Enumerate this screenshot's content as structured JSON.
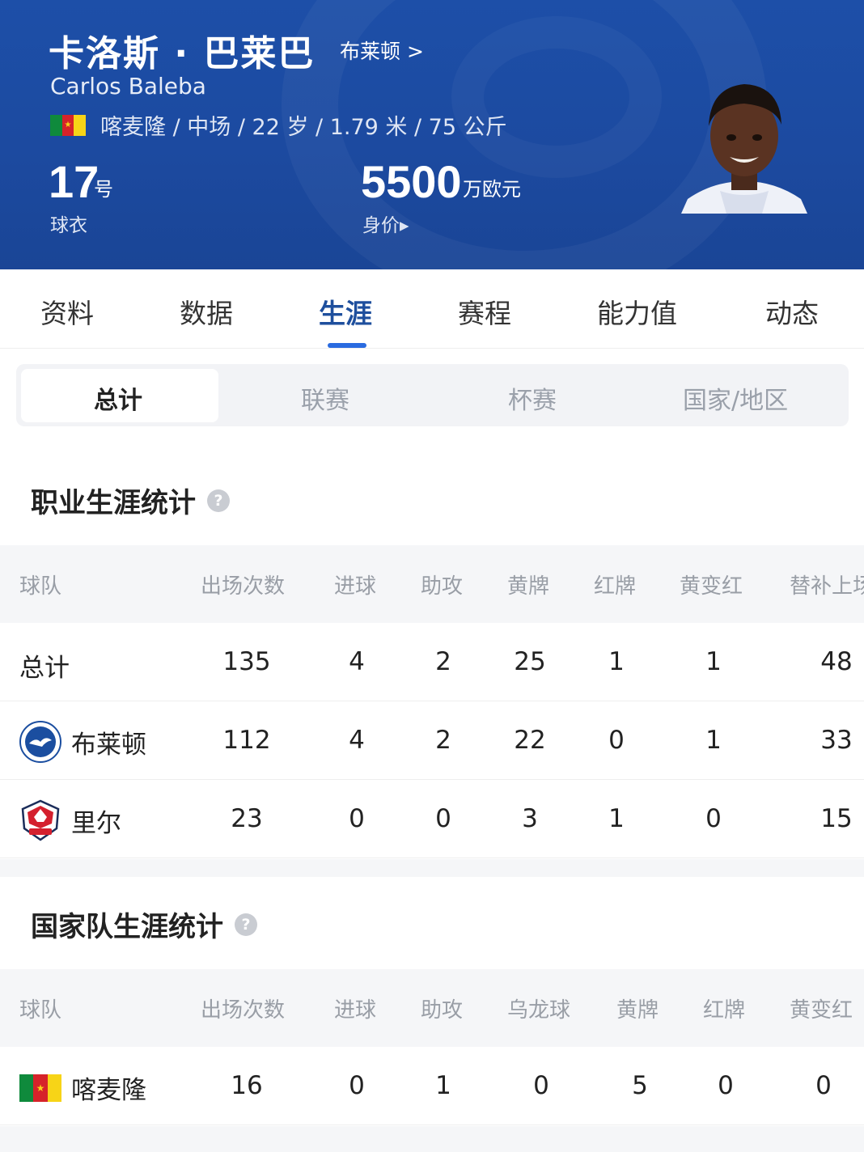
{
  "header": {
    "name_cn": "卡洛斯 · 巴莱巴",
    "club_link": "布莱顿 >",
    "name_en": "Carlos Baleba",
    "info": "喀麦隆 / 中场 / 22 岁 / 1.79 米 / 75 公斤",
    "jersey_number": "17",
    "jersey_unit": "号",
    "jersey_label": "球衣",
    "market_value": "5500",
    "market_value_unit": "万欧元",
    "market_value_label": "身价▸",
    "flag_colors": [
      "#0f8a3c",
      "#d6232a",
      "#f7d417"
    ]
  },
  "tabs": [
    "资料",
    "数据",
    "生涯",
    "赛程",
    "能力值",
    "动态"
  ],
  "active_tab": "生涯",
  "segments": [
    "总计",
    "联赛",
    "杯赛",
    "国家/地区"
  ],
  "active_segment": "总计",
  "career": {
    "title": "职业生涯统计",
    "headers": [
      "球队",
      "出场次数",
      "进球",
      "助攻",
      "黄牌",
      "红牌",
      "黄变红",
      "替补上场"
    ],
    "rows": [
      {
        "team": "总计",
        "values": [
          "135",
          "4",
          "2",
          "25",
          "1",
          "1",
          "48"
        ]
      },
      {
        "team": "布莱顿",
        "icon": "brighton-crest-icon",
        "values": [
          "112",
          "4",
          "2",
          "22",
          "0",
          "1",
          "33"
        ]
      },
      {
        "team": "里尔",
        "icon": "lille-crest-icon",
        "values": [
          "23",
          "0",
          "0",
          "3",
          "1",
          "0",
          "15"
        ]
      }
    ]
  },
  "national": {
    "title": "国家队生涯统计",
    "headers": [
      "球队",
      "出场次数",
      "进球",
      "助攻",
      "乌龙球",
      "黄牌",
      "红牌",
      "黄变红"
    ],
    "rows": [
      {
        "team": "喀麦隆",
        "icon": "cameroon-flag-icon",
        "values": [
          "16",
          "0",
          "1",
          "0",
          "5",
          "0",
          "0"
        ]
      }
    ]
  },
  "colors": {
    "header_bg": "#1c4aa0",
    "accent": "#2a6be0",
    "active_tab": "#1e4f9d"
  }
}
